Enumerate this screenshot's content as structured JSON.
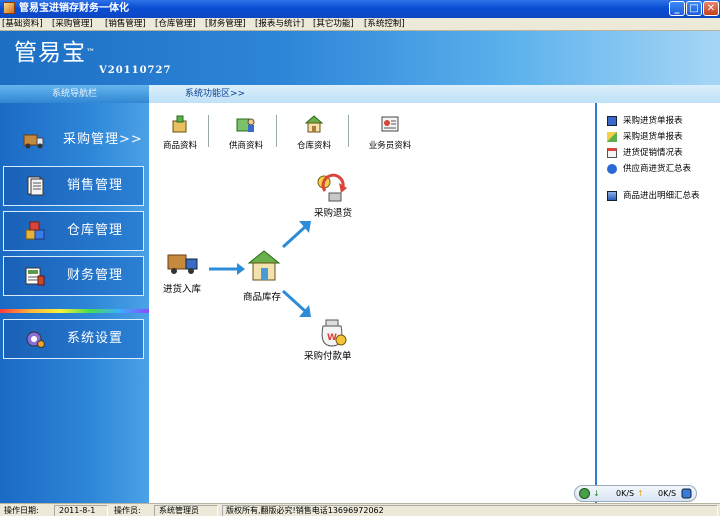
{
  "window": {
    "title": "管易宝进销存财务一体化",
    "icon": "app-icon"
  },
  "window_controls": {
    "minimize": "_",
    "maximize": "□",
    "close": "✕"
  },
  "menu": [
    "[基础资料]",
    "[采购管理]",
    "[销售管理]",
    "[仓库管理]",
    "[财务管理]",
    "[报表与统计]",
    "[其它功能]",
    "[系统控制]"
  ],
  "header": {
    "brand": "管易宝",
    "tm": "™",
    "version": "V20110727"
  },
  "tabs": {
    "nav": "系统导航栏",
    "functions": "系统功能区>>"
  },
  "sidebar": [
    {
      "label": "采购管理>>",
      "icon": "truck-icon",
      "active": true
    },
    {
      "label": "销售管理",
      "icon": "document-icon"
    },
    {
      "label": "仓库管理",
      "icon": "boxes-icon"
    },
    {
      "label": "财务管理",
      "icon": "ledger-icon"
    },
    {
      "label": "系统设置",
      "icon": "gear-icon"
    }
  ],
  "quick": [
    {
      "label": "商品资料",
      "icon": "product-icon"
    },
    {
      "label": "供商资料",
      "icon": "supplier-icon"
    },
    {
      "label": "仓库资料",
      "icon": "warehouse-icon"
    },
    {
      "label": "业务员资料",
      "icon": "staff-icon"
    }
  ],
  "flow": {
    "inbound": "进货入库",
    "inventory": "商品库存",
    "return": "采购退货",
    "payment": "采购付款单"
  },
  "reports": [
    {
      "label": "采购进货单报表",
      "icon": "report-icon"
    },
    {
      "label": "采购退货单报表",
      "icon": "return-report-icon"
    },
    {
      "label": "进货促销情况表",
      "icon": "promo-report-icon"
    },
    {
      "label": "供应商进货汇总表",
      "icon": "supplier-summary-icon"
    },
    {
      "label": "商品进出明细汇总表",
      "icon": "detail-summary-icon"
    }
  ],
  "status": {
    "date_label": "操作日期:",
    "date": "2011-8-1",
    "operator_label": "操作员:",
    "operator": "系统管理员",
    "notice": "版权所有,翻版必究!销售电话13696972062"
  },
  "network": {
    "down": "0K/S",
    "up": "0K/S"
  },
  "colors": {
    "titlebar": "#0a4dd2",
    "sidebar": "#2e86d8",
    "banner": "#1d6fc4",
    "accent": "#2d7fd0"
  }
}
